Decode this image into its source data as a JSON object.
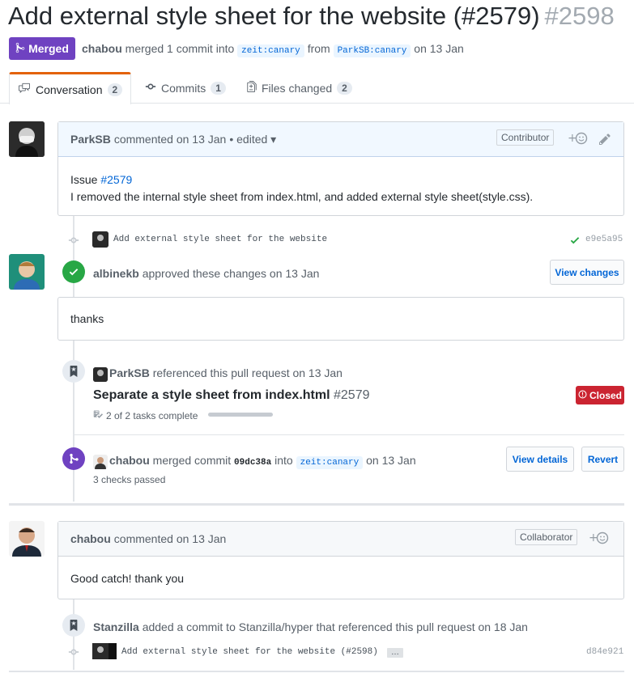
{
  "header": {
    "title": "Add external style sheet for the website (#2579)",
    "number": "#2598",
    "status_badge": "Merged",
    "author": "chabou",
    "merged_text": "merged 1 commit into",
    "base_branch": "zeit:canary",
    "from_text": "from",
    "head_branch": "ParkSB:canary",
    "date_text": "on 13 Jan"
  },
  "tabs": [
    {
      "label": "Conversation",
      "count": "2"
    },
    {
      "label": "Commits",
      "count": "1"
    },
    {
      "label": "Files changed",
      "count": "2"
    }
  ],
  "comment1": {
    "author": "ParkSB",
    "meta": "commented on 13 Jan",
    "edited": "• edited",
    "role": "Contributor",
    "issue_prefix": "Issue",
    "issue_link": "#2579",
    "body": "I removed the internal style sheet from index.html, and added external style sheet(style.css)."
  },
  "commit1": {
    "message": "Add external style sheet for the website",
    "sha": "e9e5a95"
  },
  "review": {
    "author": "albinekb",
    "text": "approved these changes on 13 Jan",
    "button": "View changes",
    "body": "thanks"
  },
  "reference": {
    "author": "ParkSB",
    "text": "referenced this pull request on 13 Jan",
    "issue_title": "Separate a style sheet from index.html",
    "issue_number": "#2579",
    "state": "Closed",
    "tasks": "2 of 2 tasks complete",
    "tasks_progress": 1.0
  },
  "merge_event": {
    "author": "chabou",
    "text": "merged commit",
    "sha": "09dc38a",
    "into": "into",
    "branch": "zeit:canary",
    "date": "on 13 Jan",
    "checks": "3 checks passed",
    "details_button": "View details",
    "revert_button": "Revert"
  },
  "comment2": {
    "author": "chabou",
    "meta": "commented on 13 Jan",
    "role": "Collaborator",
    "body": "Good catch! thank you"
  },
  "cross_ref": {
    "author": "Stanzilla",
    "text": "added a commit to Stanzilla/hyper that referenced this pull request on 18 Jan"
  },
  "commit2": {
    "message": "Add external style sheet for the website (#2598)",
    "ellipsis": "…",
    "sha": "d84e921"
  },
  "colors": {
    "merged": "#6f42c1",
    "approved": "#28a745",
    "closed": "#cb2431",
    "link": "#0366d6"
  }
}
